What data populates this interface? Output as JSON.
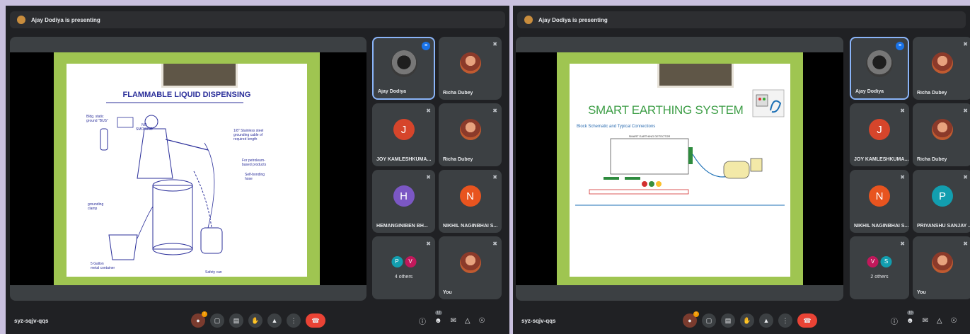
{
  "left": {
    "presenter_banner": "Ajay Dodiya is presenting",
    "slide": {
      "title": "FLAMMABLE LIQUID DISPENSING",
      "labels": [
        "Bldg. static\nground \"BUS\"",
        "NO\nSMOKING",
        "1/8\" Stainless steel\ngrounding cable of\nrequired length",
        "For petroleum-\nbased products",
        "Self-bonding\nhose",
        "grounding\nclamp",
        "5 Gallon\nmetal container",
        "Safety can"
      ]
    },
    "tiles": [
      {
        "name": "Ajay Dodiya",
        "kind": "ajay",
        "active": true
      },
      {
        "name": "Richa Dubey",
        "kind": "photo"
      },
      {
        "name": "JOY KAMLESHKUMA...",
        "initial": "J",
        "color": "#d6452b"
      },
      {
        "name": "Richa Dubey",
        "kind": "photo"
      },
      {
        "name": "HEMANGINIBEN BH...",
        "initial": "H",
        "color": "#7b57c4"
      },
      {
        "name": "NIKHIL NAGINBHAI S...",
        "initial": "N",
        "color": "#e8541f"
      },
      {
        "name": "4 others",
        "mini": [
          {
            "l": "P",
            "c": "#129eaf"
          },
          {
            "l": "V",
            "c": "#c2185b"
          }
        ]
      },
      {
        "name": "You",
        "kind": "photo"
      }
    ],
    "meeting_code": "syz-sqjv-qqs",
    "participant_count": "12"
  },
  "right": {
    "presenter_banner": "Ajay Dodiya is presenting",
    "slide": {
      "title": "SMART EARTHING SYSTEM",
      "subtitle": "Block Schematic and Typical Connections",
      "box_title": "SMART EARTHING DETECTOR"
    },
    "tiles": [
      {
        "name": "Ajay Dodiya",
        "kind": "ajay",
        "active": true
      },
      {
        "name": "Richa Dubey",
        "kind": "photo"
      },
      {
        "name": "JOY KAMLESHKUMA...",
        "initial": "J",
        "color": "#d6452b"
      },
      {
        "name": "Richa Dubey",
        "kind": "photo"
      },
      {
        "name": "NIKHIL NAGINBHAI S...",
        "initial": "N",
        "color": "#e8541f"
      },
      {
        "name": "PRIYANSHU SANJAY ...",
        "initial": "P",
        "color": "#129eaf"
      },
      {
        "name": "2 others",
        "mini": [
          {
            "l": "V",
            "c": "#c2185b"
          },
          {
            "l": "S",
            "c": "#129eaf"
          }
        ]
      },
      {
        "name": "You",
        "kind": "photo"
      }
    ],
    "meeting_code": "syz-sqjv-qqs",
    "participant_count": "10"
  },
  "icons": [
    "mic-off-icon",
    "camera-icon",
    "captions-icon",
    "raise-hand-icon",
    "present-icon",
    "more-options-icon",
    "end-call-icon",
    "info-icon",
    "people-icon",
    "chat-icon",
    "activities-icon",
    "host-controls-icon"
  ]
}
